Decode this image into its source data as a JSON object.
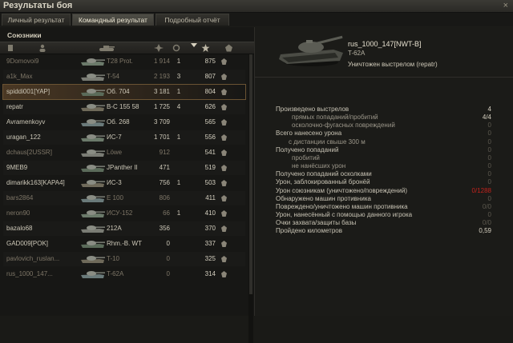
{
  "window": {
    "title": "Результаты боя",
    "close_glyph": "×"
  },
  "tabs": [
    {
      "label": "Личный результат",
      "active": false
    },
    {
      "label": "Командный результат",
      "active": true
    },
    {
      "label": "Подробный отчёт",
      "active": false
    }
  ],
  "team": {
    "label": "Союзники",
    "columns": [
      {
        "icon": "status-icon"
      },
      {
        "icon": "player-icon"
      },
      {
        "icon": "tank-icon"
      },
      {
        "icon": "damage-icon"
      },
      {
        "icon": "frag-icon"
      },
      {
        "icon": "sort-arrow-icon"
      },
      {
        "icon": "experience-star-icon"
      },
      {
        "icon": "medal-icon"
      }
    ],
    "rows": [
      {
        "player": "9Domovoi9",
        "vehicle": "T28 Prot.",
        "damage": "1 914",
        "kills": "1",
        "xp": "875",
        "dead": true,
        "damage_dim": true
      },
      {
        "player": "a1k_Max",
        "vehicle": "T-54",
        "damage": "2 193",
        "kills": "3",
        "xp": "807",
        "dead": true,
        "damage_dim": true
      },
      {
        "player": "spiddi001[YAP]",
        "vehicle": "Об. 704",
        "damage": "3 181",
        "kills": "1",
        "xp": "804",
        "dead": false,
        "highlight": true
      },
      {
        "player": "repatr",
        "vehicle": "В-С 155 58",
        "damage": "1 725",
        "kills": "4",
        "xp": "626",
        "dead": false
      },
      {
        "player": "Avramenkoyv",
        "vehicle": "Об. 268",
        "damage": "3 709",
        "kills": "",
        "xp": "565",
        "dead": false
      },
      {
        "player": "uragan_122",
        "vehicle": "ИС-7",
        "damage": "1 701",
        "kills": "1",
        "xp": "556",
        "dead": false
      },
      {
        "player": "dchaus[2USSR]",
        "vehicle": "Löwe",
        "damage": "912",
        "kills": "",
        "xp": "541",
        "dead": true,
        "damage_dim": true
      },
      {
        "player": "9MEB9",
        "vehicle": "JPanther II",
        "damage": "471",
        "kills": "",
        "xp": "519",
        "dead": false
      },
      {
        "player": "dimarikk163[KAPA4]",
        "vehicle": "ИС-3",
        "damage": "756",
        "kills": "1",
        "xp": "503",
        "dead": false
      },
      {
        "player": "bars2864",
        "vehicle": "E 100",
        "damage": "806",
        "kills": "",
        "xp": "411",
        "dead": true,
        "damage_dim": true
      },
      {
        "player": "neron90",
        "vehicle": "ИСУ-152",
        "damage": "66",
        "kills": "1",
        "xp": "410",
        "dead": true,
        "damage_dim": true
      },
      {
        "player": "bazalo68",
        "vehicle": "212A",
        "damage": "356",
        "kills": "",
        "xp": "370",
        "dead": false
      },
      {
        "player": "GAD009[POK]",
        "vehicle": "Rhm.-B. WT",
        "damage": "0",
        "kills": "",
        "xp": "337",
        "dead": false
      },
      {
        "player": "pavlovich_ruslan...",
        "vehicle": "T-10",
        "damage": "0",
        "kills": "",
        "xp": "325",
        "dead": true,
        "damage_dim": true
      },
      {
        "player": "rus_1000_147...",
        "vehicle": "T-62A",
        "damage": "0",
        "kills": "",
        "xp": "314",
        "dead": true,
        "damage_dim": true
      }
    ]
  },
  "detail": {
    "player": "rus_1000_147[NWT-B]",
    "vehicle": "T-62A",
    "death_text": "Уничтожен выстрелом (repatr)",
    "stats": [
      {
        "label": "Произведено выстрелов",
        "value": "4",
        "level": 0
      },
      {
        "label": "прямых попаданий/пробитий",
        "value": "4/4",
        "level": 2
      },
      {
        "label": "осколочно-фугасных повреждений",
        "value": "0",
        "level": 2,
        "dim": true
      },
      {
        "label": "Всего нанесено урона",
        "value": "0",
        "level": 0,
        "dim": true
      },
      {
        "label": "с дистанции свыше 300 м",
        "value": "0",
        "level": 1,
        "dim": true
      },
      {
        "label": "Получено попаданий",
        "value": "0",
        "level": 0,
        "dim": true
      },
      {
        "label": "пробитий",
        "value": "0",
        "level": 2,
        "dim": true
      },
      {
        "label": "не нанёсших урон",
        "value": "0",
        "level": 2,
        "dim": true
      },
      {
        "label": "Получено попаданий осколками",
        "value": "0",
        "level": 0,
        "dim": true
      },
      {
        "label": "Урон, заблокированный бронёй",
        "value": "0",
        "level": 0,
        "dim": true
      },
      {
        "label": "Урон союзникам (уничтожено/повреждений)",
        "value": "0/1288",
        "level": 0,
        "red": true
      },
      {
        "label": "Обнаружено машин противника",
        "value": "0",
        "level": 0,
        "dim": true
      },
      {
        "label": "Повреждено/уничтожено машин противника",
        "value": "0/0",
        "level": 0,
        "dim": true
      },
      {
        "label": "Урон, нанесённый с помощью данного игрока",
        "value": "0",
        "level": 0,
        "dim": true
      },
      {
        "label": "Очки захвата/защиты базы",
        "value": "0/0",
        "level": 0,
        "dim": true
      },
      {
        "label": "Пройдено километров",
        "value": "0,59",
        "level": 0
      }
    ]
  }
}
